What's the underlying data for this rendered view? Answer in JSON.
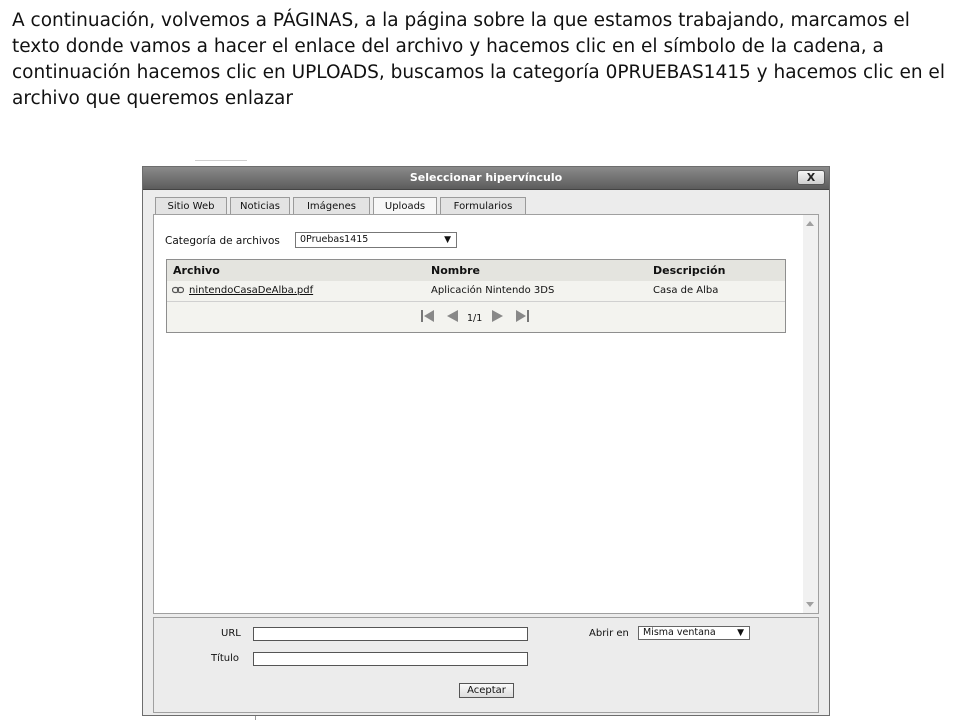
{
  "instructions": "A continuación, volvemos a PÁGINAS, a la página sobre la que estamos trabajando, marcamos el texto donde vamos a hacer el enlace del archivo y hacemos clic en el símbolo de la cadena, a continuación hacemos clic en UPLOADS, buscamos la categoría 0PRUEBAS1415 y hacemos clic en el archivo que queremos enlazar",
  "dialog": {
    "title": "Seleccionar hipervínculo",
    "close_label": "X",
    "tabs": [
      {
        "label": "Sitio Web",
        "active": false
      },
      {
        "label": "Noticias",
        "active": false
      },
      {
        "label": "Imágenes",
        "active": false
      },
      {
        "label": "Uploads",
        "active": true
      },
      {
        "label": "Formularios",
        "active": false
      }
    ],
    "category": {
      "label": "Categoría de archivos",
      "selected": "0Pruebas1415"
    },
    "table": {
      "columns": [
        "Archivo",
        "Nombre",
        "Descripción"
      ],
      "rows": [
        {
          "archivo": "nintendoCasaDeAlba.pdf",
          "nombre": "Aplicación Nintendo 3DS",
          "descripcion": "Casa de Alba",
          "icon": "link-icon"
        }
      ],
      "pager": "1/1"
    },
    "form": {
      "url_label": "URL",
      "url_value": "",
      "title_label": "Título",
      "title_value": "",
      "open_in_label": "Abrir en",
      "open_in_selected": "Misma ventana",
      "accept_label": "Aceptar"
    }
  },
  "colors": {
    "titlebar": "#6e6e6e",
    "dialog_bg": "#ececec",
    "table_header": "#e4e4df"
  }
}
